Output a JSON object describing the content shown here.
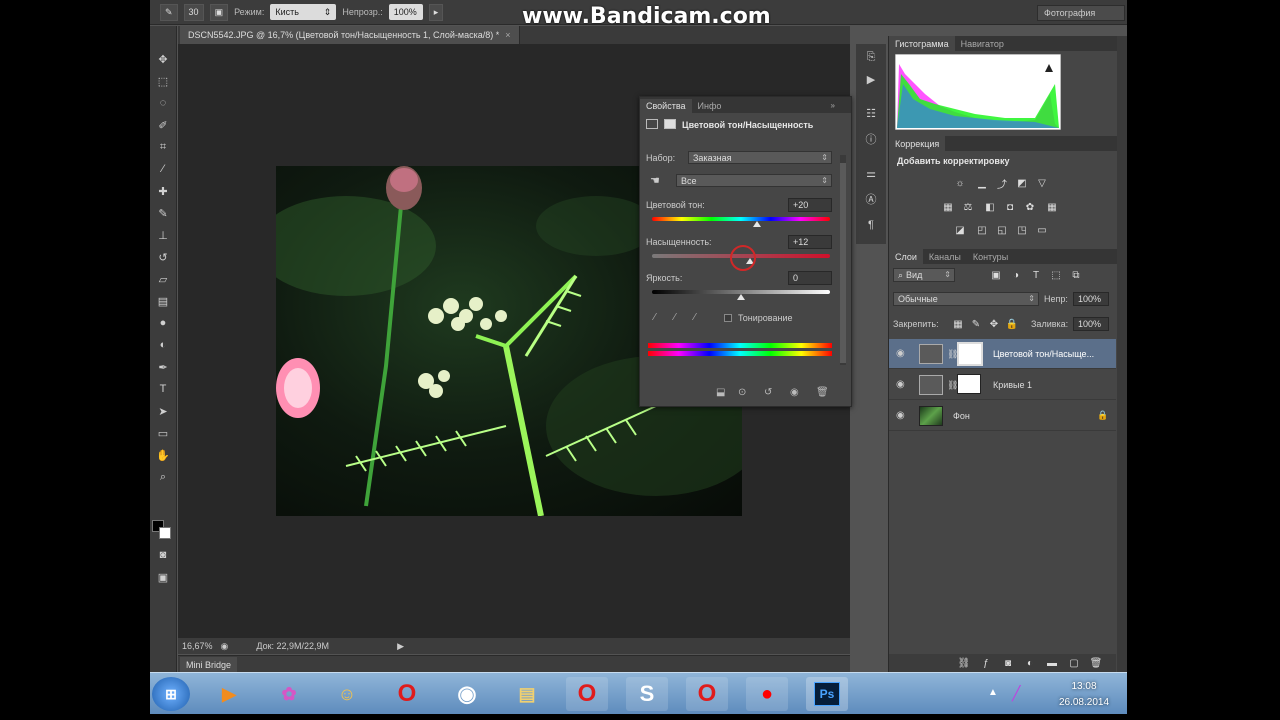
{
  "watermark": "www.Bandicam.com",
  "options_bar": {
    "brush_size": "30",
    "mode_label": "Режим:",
    "mode_value": "Кисть",
    "opacity_label": "Непрозр.:",
    "opacity_value": "100%",
    "workspace": "Фотография"
  },
  "document": {
    "tab_title": "DSCN5542.JPG @ 16,7% (Цветовой тон/Насыщенность 1, Слой-маска/8) *",
    "zoom": "16,67%",
    "doc_info": "Док: 22,9M/22,9M"
  },
  "mini_bridge": "Mini Bridge",
  "properties_panel": {
    "tabs": [
      "Свойства",
      "Инфо"
    ],
    "header": "Цветовой тон/Насыщенность",
    "preset_label": "Набор:",
    "preset_value": "Заказная",
    "channel_value": "Все",
    "hue_label": "Цветовой тон:",
    "hue_value": "+20",
    "hue_level_pct": 59,
    "saturation_label": "Насыщенность:",
    "saturation_value": "+12",
    "saturation_level_pct": 55,
    "lightness_label": "Яркость:",
    "lightness_value": "0",
    "lightness_level_pct": 50,
    "colorize_label": "Тонирование"
  },
  "histogram_panel": {
    "tabs": [
      "Гистограмма",
      "Навигатор"
    ]
  },
  "adjustments_panel": {
    "tabs": [
      "Коррекция"
    ],
    "title": "Добавить корректировку"
  },
  "layers_panel": {
    "tabs": [
      "Слои",
      "Каналы",
      "Контуры"
    ],
    "filter_kind": "Вид",
    "blend_mode": "Обычные",
    "opacity_label": "Непр:",
    "opacity_value": "100%",
    "lock_label": "Закрепить:",
    "fill_label": "Заливка:",
    "fill_value": "100%",
    "layers": [
      {
        "name": "Цветовой тон/Насыще..."
      },
      {
        "name": "Кривые 1"
      },
      {
        "name": "Фон"
      }
    ]
  },
  "taskbar": {
    "ps_label": "Ps",
    "time": "13:08",
    "date": "26.08.2014"
  }
}
